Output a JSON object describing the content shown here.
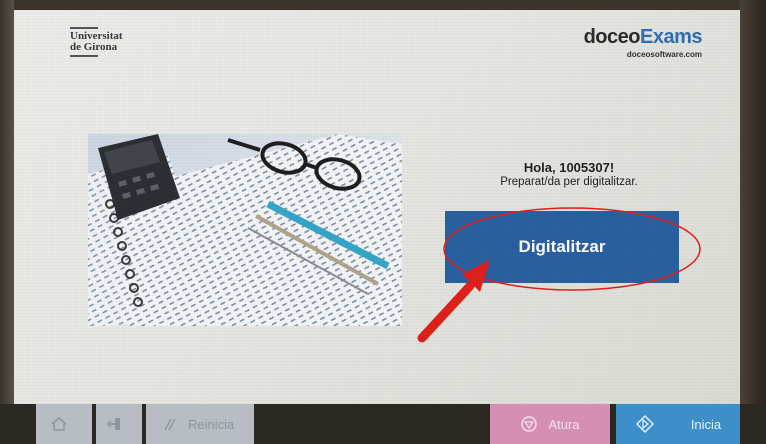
{
  "header": {
    "university_logo_line1": "Universitat",
    "university_logo_line2": "de Girona",
    "brand_prefix": "doceo",
    "brand_suffix": "Exams",
    "brand_url": "doceosoftware.com"
  },
  "main": {
    "greeting": "Hola, 1005307!",
    "status": "Preparat/da per digitalitzar.",
    "scan_button": "Digitalitzar"
  },
  "footer": {
    "home_icon": "home-icon",
    "exit_icon": "exit-icon",
    "reset_label": "Reinicia",
    "stop_label": "Atura",
    "start_label": "Inicia"
  },
  "colors": {
    "scan_button": "#2a5fa0",
    "stop_button": "#d58fb2",
    "start_button": "#3d8fc9",
    "annotation": "#e0201a"
  }
}
